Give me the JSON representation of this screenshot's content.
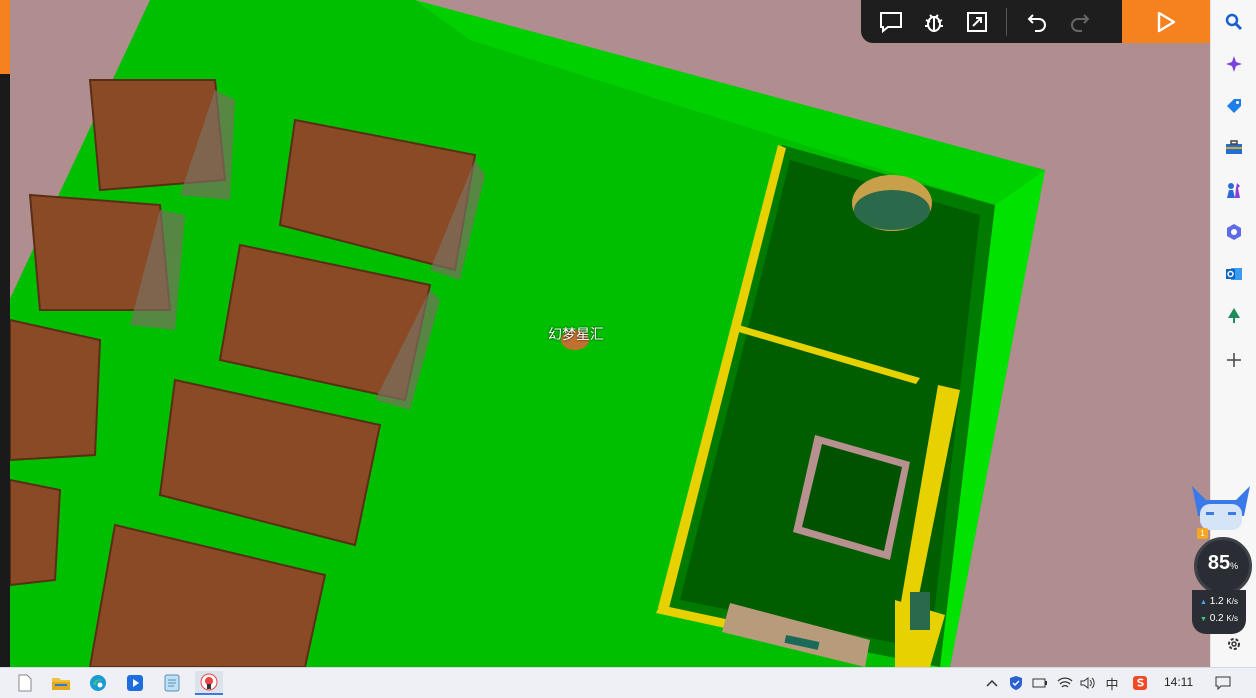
{
  "scene": {
    "player_name": "幻梦星汇"
  },
  "toolbar": {
    "buttons": [
      "comment-icon",
      "bug-icon",
      "expand-icon",
      "undo-icon",
      "redo-icon"
    ],
    "run_icon": "play-icon",
    "accent_color": "#f5821f"
  },
  "sidebar": {
    "items": [
      "search-icon",
      "copilot-sparkle-icon",
      "tag-icon",
      "toolbox-icon",
      "chess-icon",
      "office-icon",
      "outlook-icon",
      "tree-icon",
      "add-icon",
      "settings-icon"
    ]
  },
  "widget": {
    "percent": "85",
    "percent_unit": "%",
    "upload": "1.2",
    "upload_unit": "K/s",
    "download": "0.2",
    "download_unit": "K/s",
    "badge": "1"
  },
  "taskbar": {
    "apps": [
      "file-icon",
      "file-explorer-icon",
      "edge-icon",
      "video-app-icon",
      "notepad-icon",
      "game-app-icon"
    ],
    "tray": [
      "chevron-up-icon",
      "shield-icon",
      "battery-icon",
      "wifi-icon",
      "volume-icon",
      "ime-icon",
      "sogou-icon"
    ],
    "ime_label": "中",
    "time": "14:11"
  }
}
